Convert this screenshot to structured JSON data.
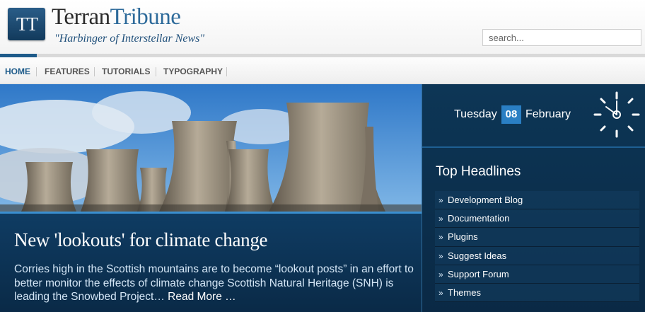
{
  "header": {
    "logo_mark": "TT",
    "brand_first": "Terran",
    "brand_second": "Tribune",
    "tagline": "\"Harbinger of Interstellar News\"",
    "search_placeholder": "search..."
  },
  "nav": {
    "items": [
      {
        "label": "HOME",
        "active": true
      },
      {
        "label": "FEATURES",
        "active": false
      },
      {
        "label": "TUTORIALS",
        "active": false
      },
      {
        "label": "TYPOGRAPHY",
        "active": false
      }
    ]
  },
  "featured": {
    "title": "New 'lookouts' for climate change",
    "excerpt": "Corries high in the Scottish mountains are to become “lookout posts” in an effort to better monitor the effects of climate change Scottish Natural Heritage (SNH) is leading the Snowbed Project…",
    "read_more": "Read More …"
  },
  "sidebar": {
    "day": "Tuesday",
    "date_number": "08",
    "month": "February",
    "headlines_title": "Top Headlines",
    "headlines": [
      "Development Blog",
      "Documentation",
      "Plugins",
      "Suggest Ideas",
      "Support Forum",
      "Themes"
    ]
  },
  "colors": {
    "accent": "#1e5b8a",
    "brand_blue": "#2d6a9a",
    "sidebar_bg": "#0d3656",
    "date_badge": "#2a7fc4"
  },
  "icons": {
    "clock": "clock-icon",
    "bullet": "double-chevron-right-icon"
  }
}
